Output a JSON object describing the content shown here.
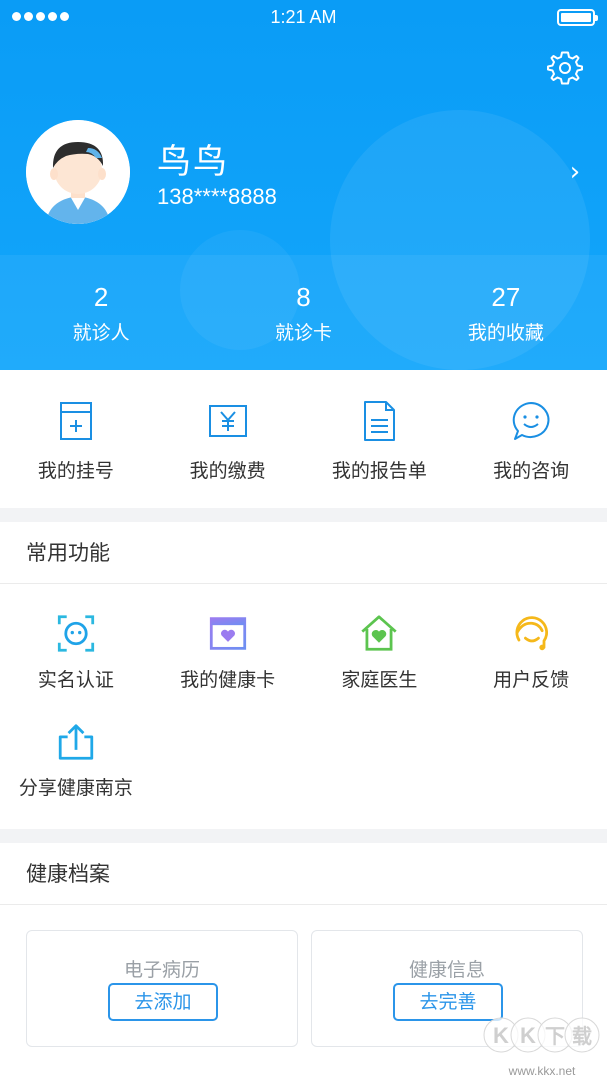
{
  "status_bar": {
    "time": "1:21 AM"
  },
  "header": {
    "username": "鸟鸟",
    "phone": "138****8888",
    "stats": [
      {
        "value": "2",
        "label": "就诊人"
      },
      {
        "value": "8",
        "label": "就诊卡"
      },
      {
        "value": "27",
        "label": "我的收藏"
      }
    ]
  },
  "quick": [
    {
      "label": "我的挂号",
      "icon": "registration-icon"
    },
    {
      "label": "我的缴费",
      "icon": "payment-icon"
    },
    {
      "label": "我的报告单",
      "icon": "report-icon"
    },
    {
      "label": "我的咨询",
      "icon": "consult-icon"
    }
  ],
  "common": {
    "title": "常用功能",
    "items": [
      {
        "label": "实名认证",
        "icon": "face-verify-icon"
      },
      {
        "label": "我的健康卡",
        "icon": "health-card-icon"
      },
      {
        "label": "家庭医生",
        "icon": "home-heart-icon"
      },
      {
        "label": "用户反馈",
        "icon": "feedback-icon"
      },
      {
        "label": "分享健康南京",
        "icon": "share-icon"
      }
    ]
  },
  "records": {
    "title": "健康档案",
    "cards": [
      {
        "title": "电子病历",
        "button": "去添加"
      },
      {
        "title": "健康信息",
        "button": "去完善"
      }
    ]
  },
  "watermark": {
    "brand": "KK下载",
    "url": "www.kkx.net"
  },
  "colors": {
    "header_blue": "#0a9cf6",
    "icon_blue": "#1a8fe3",
    "button_blue": "#2b95e9"
  }
}
